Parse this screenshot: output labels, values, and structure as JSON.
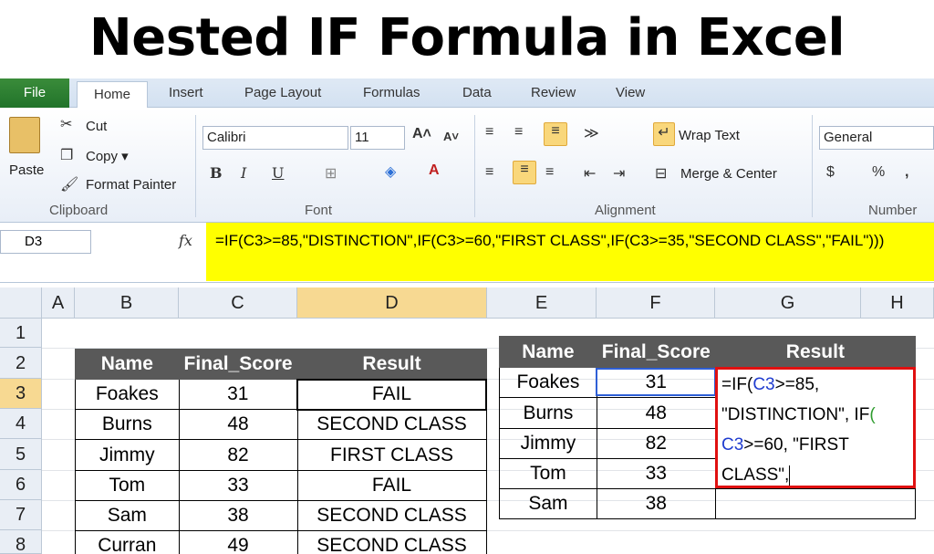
{
  "title": "Nested IF Formula in Excel",
  "tabs": [
    "File",
    "Home",
    "Insert",
    "Page Layout",
    "Formulas",
    "Data",
    "Review",
    "View"
  ],
  "ribbon": {
    "clipboard": {
      "paste": "Paste",
      "cut": "Cut",
      "copy": "Copy ▾",
      "format_painter": "Format Painter",
      "label": "Clipboard"
    },
    "font": {
      "name": "Calibri",
      "size": "11",
      "label": "Font"
    },
    "alignment": {
      "wrap": "Wrap Text",
      "merge": "Merge & Center",
      "label": "Alignment"
    },
    "number": {
      "format": "General",
      "label": "Number"
    }
  },
  "formula_bar": {
    "cell": "D3",
    "fx": "fx",
    "formula": "=IF(C3>=85,\"DISTINCTION\",IF(C3>=60,\"FIRST CLASS\",IF(C3>=35,\"SECOND CLASS\",\"FAIL\")))"
  },
  "columns": [
    "A",
    "B",
    "C",
    "D",
    "E",
    "F",
    "G",
    "H"
  ],
  "rows": [
    "1",
    "2",
    "3",
    "4",
    "5",
    "6",
    "7",
    "8"
  ],
  "table1": {
    "headers": [
      "Name",
      "Final_Score",
      "Result"
    ],
    "rows": [
      [
        "Foakes",
        "31",
        "FAIL"
      ],
      [
        "Burns",
        "48",
        "SECOND CLASS"
      ],
      [
        "Jimmy",
        "82",
        "FIRST CLASS"
      ],
      [
        "Tom",
        "33",
        "FAIL"
      ],
      [
        "Sam",
        "38",
        "SECOND CLASS"
      ],
      [
        "Curran",
        "49",
        "SECOND CLASS"
      ]
    ]
  },
  "table2": {
    "headers": [
      "Name",
      "Final_Score",
      "Result"
    ],
    "rows": [
      [
        "Foakes",
        "31",
        ""
      ],
      [
        "Burns",
        "48",
        ""
      ],
      [
        "Jimmy",
        "82",
        ""
      ],
      [
        "Tom",
        "33",
        ""
      ],
      [
        "Sam",
        "38",
        ""
      ]
    ]
  },
  "edit_formula": {
    "p1": "=IF(",
    "p2": "C3",
    "p3": ">=85,",
    "p4": "\"DISTINCTION\", IF",
    "p5": "(",
    "p6": "C3",
    "p7": ">=60, \"FIRST",
    "p8": "CLASS\","
  }
}
